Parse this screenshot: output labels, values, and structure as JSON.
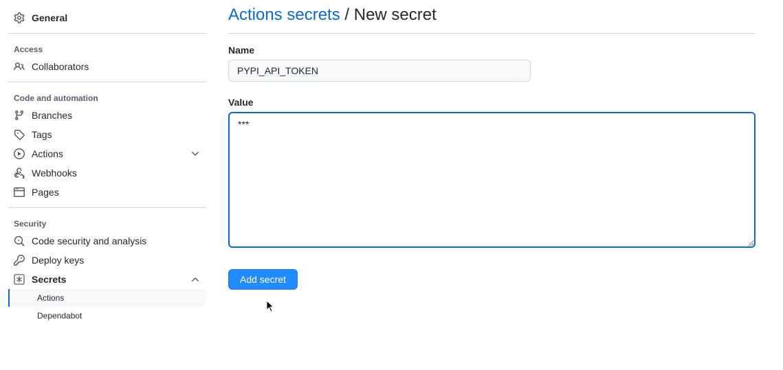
{
  "sidebar": {
    "general": "General",
    "access_heading": "Access",
    "collaborators": "Collaborators",
    "code_heading": "Code and automation",
    "branches": "Branches",
    "tags": "Tags",
    "actions": "Actions",
    "webhooks": "Webhooks",
    "pages": "Pages",
    "security_heading": "Security",
    "code_security": "Code security and analysis",
    "deploy_keys": "Deploy keys",
    "secrets": "Secrets",
    "secrets_sub_actions": "Actions",
    "secrets_sub_dependabot": "Dependabot"
  },
  "header": {
    "breadcrumb_link": "Actions secrets",
    "breadcrumb_sep": "/",
    "breadcrumb_current": "New secret"
  },
  "form": {
    "name_label": "Name",
    "name_value": "PYPI_API_TOKEN",
    "value_label": "Value",
    "value_value": "***",
    "submit_label": "Add secret"
  }
}
